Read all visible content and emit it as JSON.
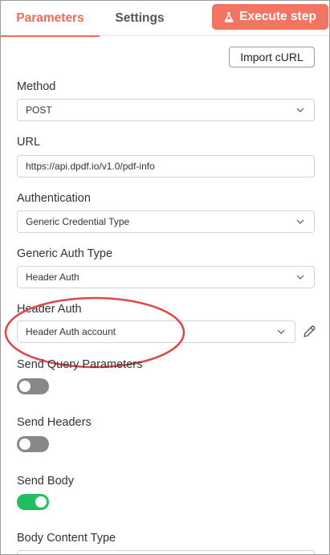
{
  "tabs": {
    "parameters": "Parameters",
    "settings": "Settings"
  },
  "execute_button": {
    "label": "Execute step",
    "icon": "flask-icon",
    "color": "#f27562"
  },
  "import_button": {
    "label": "Import cURL"
  },
  "fields": {
    "method": {
      "label": "Method",
      "value": "POST"
    },
    "url": {
      "label": "URL",
      "value": "https://api.dpdf.io/v1.0/pdf-info"
    },
    "authentication": {
      "label": "Authentication",
      "value": "Generic Credential Type"
    },
    "generic_auth_type": {
      "label": "Generic Auth Type",
      "value": "Header Auth"
    },
    "header_auth": {
      "label": "Header Auth",
      "value": "Header Auth account"
    },
    "send_query_parameters": {
      "label": "Send Query Parameters",
      "enabled": false
    },
    "send_headers": {
      "label": "Send Headers",
      "enabled": false
    },
    "send_body": {
      "label": "Send Body",
      "enabled": true
    },
    "body_content_type": {
      "label": "Body Content Type"
    }
  },
  "colors": {
    "accent": "#f26b57",
    "toggle_on": "#1fbf60",
    "toggle_off": "#888888",
    "annotation": "#e0474a"
  }
}
